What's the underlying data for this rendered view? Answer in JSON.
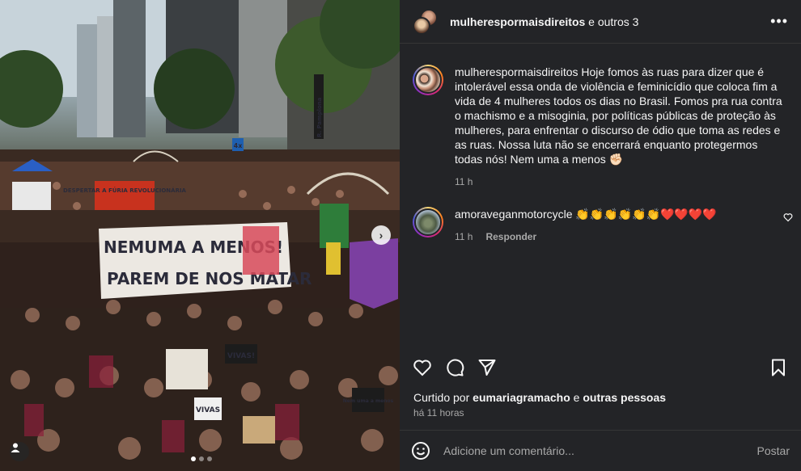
{
  "photo": {
    "alt_icons": [
      "chevron-right-icon",
      "user-tag-icon"
    ],
    "carousel_next": "›",
    "carousel_dots": 3,
    "carousel_active": 0,
    "signs": {
      "main_banner_line1": "NEMUMA A MENOS!",
      "main_banner_line2": "PAREM DE NOS MATAR",
      "red_banner": "DESPERTAR A FÚRIA REVOLUCIONÁRIA",
      "small_sign_1": "VIVAS!",
      "small_sign_2": "VIVAS",
      "small_sign_3": "Nem uma a menos",
      "street_sign": "R. Pamplona",
      "bus_sign": "4x"
    }
  },
  "header": {
    "username": "mulherespormaisdireitos",
    "rest": " e outros 3",
    "more_label": "•••"
  },
  "comments": [
    {
      "user": "mulherespormaisdireitos",
      "text": " Hoje fomos às ruas para dizer que é intolerável essa onda de violência e feminicídio que coloca fim a vida de 4 mulheres todos os dias no Brasil. Fomos pra rua contra o machismo e a misoginia, por políticas públicas de proteção às mulheres, para enfrentar o discurso de ódio que toma as redes e as ruas. Nossa luta não se encerrará enquanto protegermos todas nós! Nem uma a menos ✊🏻",
      "time": "11 h"
    },
    {
      "user": "amoraveganmotorcycle",
      "text": " 👏👏👏👏👏👏❤️❤️❤️❤️",
      "time": "11 h",
      "reply": "Responder"
    }
  ],
  "likes": {
    "prefix": "Curtido por ",
    "user": "eumariagramacho",
    "middle": " e ",
    "others": "outras pessoas"
  },
  "time_ago": "há 11 horas",
  "comment_input": {
    "placeholder": "Adicione um comentário...",
    "post_label": "Postar"
  },
  "colors": {
    "panel_bg": "#232427",
    "text": "#f5f5f5",
    "muted": "#a8a8a8",
    "red_banner": "#c8321e",
    "purple_banner": "#7b3fa0",
    "green_flag": "#2e7d3a"
  }
}
